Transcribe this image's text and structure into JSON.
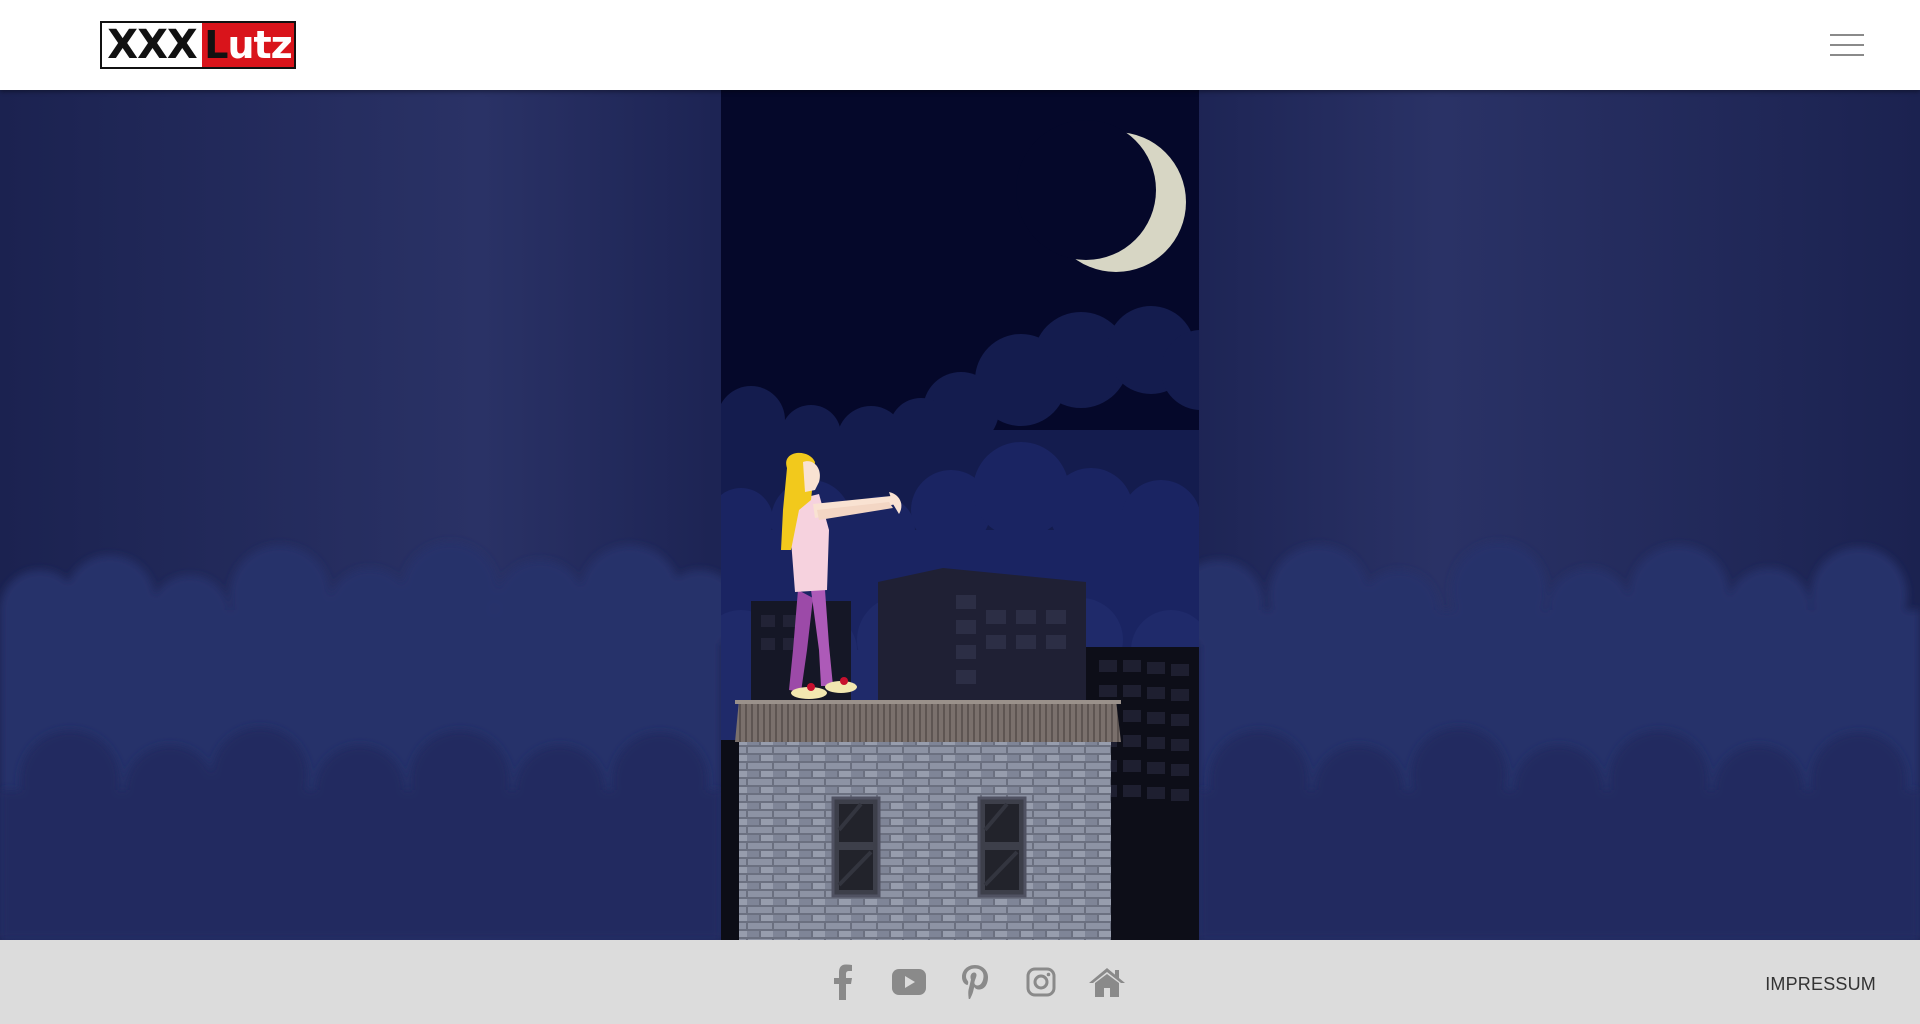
{
  "header": {
    "logo": {
      "part1": "XXX",
      "part2_first": "L",
      "part2_rest": "utz"
    },
    "menu_icon": "hamburger-menu-icon"
  },
  "scene": {
    "description_icons": [
      "moon-icon",
      "cloud-icon",
      "building-icon",
      "sleepwalker-character"
    ],
    "colors": {
      "sky": "#05082a",
      "clouds": "#1d2866",
      "moon": "#d7d6c4"
    }
  },
  "footer": {
    "social_icons": [
      "facebook-icon",
      "youtube-icon",
      "pinterest-icon",
      "instagram-icon",
      "home-icon"
    ],
    "impressum_label": "IMPRESSUM"
  },
  "colors": {
    "brand_red": "#d9141b",
    "footer_bg": "#dcdcdc",
    "icon_grey": "#8a8a8a"
  }
}
